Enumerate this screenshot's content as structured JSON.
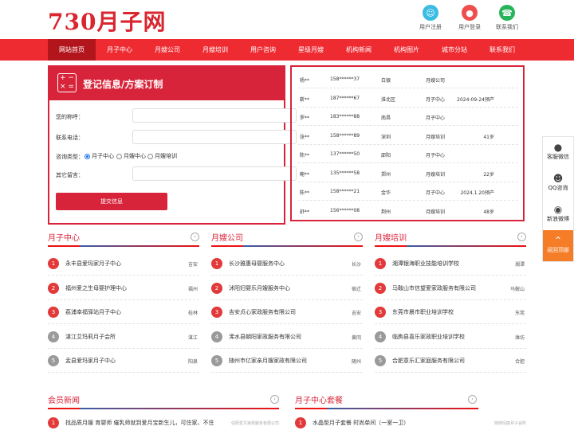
{
  "logo": "730月子网",
  "header_links": [
    {
      "label": "用户注册",
      "color": "#3bbce3",
      "icon": "user-icon"
    },
    {
      "label": "用户登录",
      "color": "#ef4e4e",
      "icon": "lock-icon"
    },
    {
      "label": "联系我们",
      "color": "#27b45b",
      "icon": "phone-icon"
    }
  ],
  "nav": [
    "网站首页",
    "月子中心",
    "月嫂公司",
    "月嫂培训",
    "用户咨询",
    "星级月嫂",
    "机构新闻",
    "机构图片",
    "城市分站",
    "联系我们"
  ],
  "form": {
    "title": "登记信息/方案订制",
    "icon_text": "+ −\n× =",
    "name_label": "您的称呼：",
    "phone_label": "联系电话：",
    "type_label": "咨询类型：",
    "options": [
      "月子中心",
      "月嫂中心",
      "月嫂培训"
    ],
    "msg_label": "其它留言：",
    "submit": "提交信息"
  },
  "orders": [
    [
      "杨**",
      "158******37",
      "白银",
      "月嫂公司",
      ""
    ],
    [
      "靳**",
      "187******67",
      "淮北区",
      "月子中心",
      "2024-09-24预产"
    ],
    [
      "罗**",
      "183******88",
      "南昌",
      "月子中心",
      ""
    ],
    [
      "张**",
      "158******89",
      "深圳",
      "月嫂培训",
      "41岁"
    ],
    [
      "陈**",
      "137******50",
      "邵阳",
      "月子中心",
      ""
    ],
    [
      "鲍**",
      "135******58",
      "郑州",
      "月嫂培训",
      "22岁"
    ],
    [
      "陈**",
      "158******21",
      "金华",
      "月子中心",
      "2024.1.20预产"
    ],
    [
      "舒**",
      "156******08",
      "荆州",
      "月嫂培训",
      "48岁"
    ]
  ],
  "sections": [
    {
      "title": "月子中心",
      "items": [
        [
          "永丰县爱玛家月子中心",
          "吉安"
        ],
        [
          "福州爱之生母婴护理中心",
          "福州"
        ],
        [
          "荔浦幸福驿站月子中心",
          "桂林"
        ],
        [
          "湛江艾玛莉月子会所",
          "湛江"
        ],
        [
          "盂县爱玛家月子中心",
          "阳泉"
        ]
      ]
    },
    {
      "title": "月嫂公司",
      "items": [
        [
          "长沙雅惠母婴服务中心",
          "长沙"
        ],
        [
          "沭阳妇婴乐月嫂服务中心",
          "宿迁"
        ],
        [
          "吉安贞心家政服务有限公司",
          "吉安"
        ],
        [
          "浠水县朝阳家政服务有限公司",
          "黄冈"
        ],
        [
          "随州市亿家亲月嫂家政有限公司",
          "随州"
        ]
      ]
    },
    {
      "title": "月嫂培训",
      "items": [
        [
          "湘潭银海职业技能培训学校",
          "湘潭"
        ],
        [
          "马鞍山市信望爱家政服务有限公司",
          "马鞍山"
        ],
        [
          "东莞市晨市职业培训学校",
          "东莞"
        ],
        [
          "临朐县喜乐家政职业培训学校",
          "潍坊"
        ],
        [
          "合肥意乐汇家庭服务有限公司",
          "合肥"
        ]
      ]
    }
  ],
  "bottom": {
    "news_title": "会员新闻",
    "news_item": "找品质月嫂 育婴师 催乳师就到爱月宝新生儿，可住家、不住",
    "news_src": "信阳爱贝家政服务有限公司",
    "pkg_title": "月子中心套餐",
    "pkg_item": "水晶型月子套餐 时尚单间（一室一卫）",
    "pkg_src": "妹妹玛丽月子会所"
  },
  "side": [
    {
      "label": "客服微信",
      "icon": "wechat-icon"
    },
    {
      "label": "QQ咨询",
      "icon": "qq-icon"
    },
    {
      "label": "新浪微博",
      "icon": "weibo-icon"
    },
    {
      "label": "返回顶部",
      "icon": "arrow-up-icon"
    }
  ],
  "num_colors": [
    "#e23a3a",
    "#e23a3a",
    "#e23a3a",
    "#9a9a9a",
    "#9a9a9a"
  ]
}
